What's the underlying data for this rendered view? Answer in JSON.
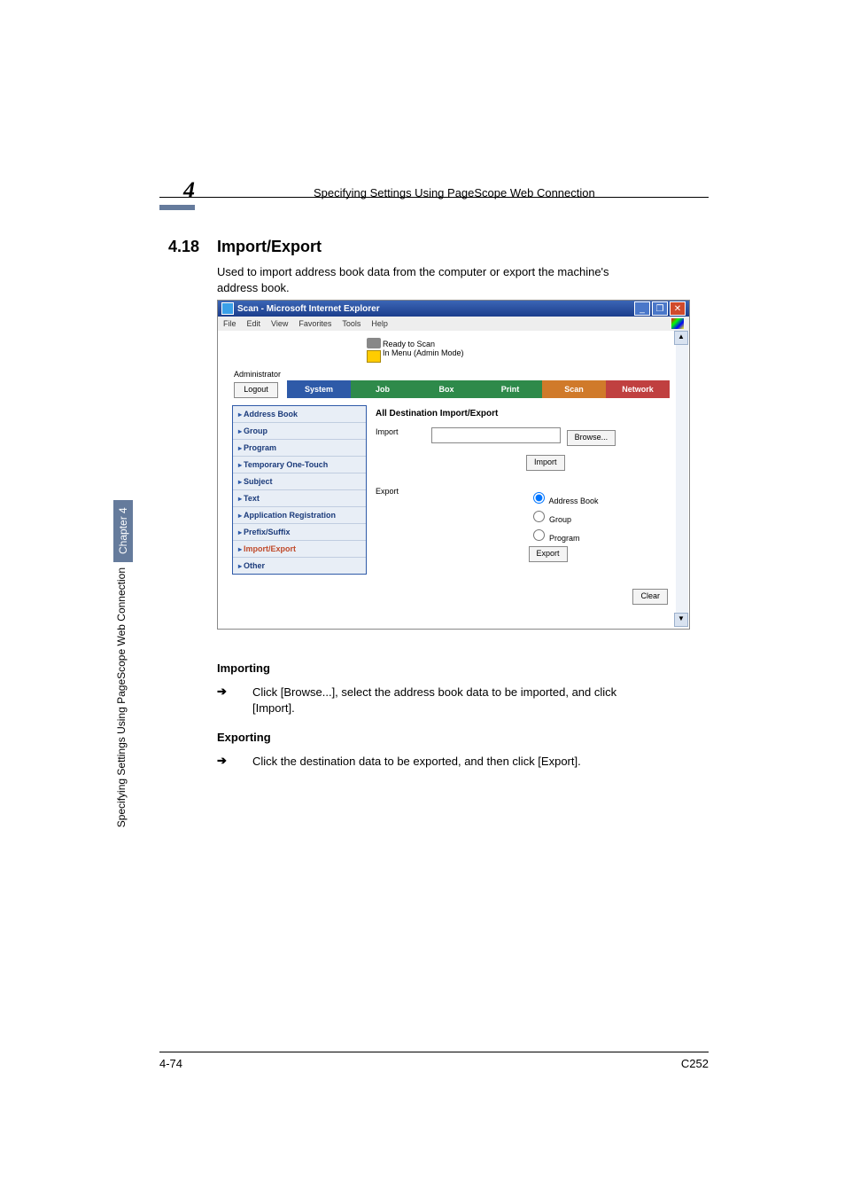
{
  "header": {
    "chapter_num": "4",
    "title": "Specifying Settings Using PageScope Web Connection"
  },
  "section": {
    "number": "4.18",
    "title": "Import/Export",
    "description": "Used to import address book data from the computer or export the machine's address book."
  },
  "importing": {
    "heading": "Importing",
    "arrow": "➔",
    "text": "Click [Browse...], select the address book data to be imported, and click [Import]."
  },
  "exporting": {
    "heading": "Exporting",
    "arrow": "➔",
    "text": "Click the destination data to be exported, and then click [Export]."
  },
  "footer": {
    "left": "4-74",
    "right": "C252"
  },
  "side": {
    "chapter": "Chapter 4",
    "label": "Specifying Settings Using PageScope Web Connection"
  },
  "screenshot": {
    "window_title": "Scan - Microsoft Internet Explorer",
    "menus": [
      "File",
      "Edit",
      "View",
      "Favorites",
      "Tools",
      "Help"
    ],
    "status1": "Ready to Scan",
    "status2": "In Menu (Admin Mode)",
    "admin_label": "Administrator",
    "logout": "Logout",
    "tabs": {
      "system": "System",
      "job": "Job",
      "box": "Box",
      "print": "Print",
      "scan": "Scan",
      "network": "Network"
    },
    "side_items": [
      "Address Book",
      "Group",
      "Program",
      "Temporary One-Touch",
      "Subject",
      "Text",
      "Application Registration",
      "Prefix/Suffix",
      "Import/Export",
      "Other"
    ],
    "panel_title": "All Destination Import/Export",
    "import_label": "Import",
    "browse": "Browse...",
    "import_btn": "Import",
    "export_label": "Export",
    "radios": {
      "address": "Address Book",
      "group": "Group",
      "program": "Program"
    },
    "export_btn": "Export",
    "clear": "Clear",
    "win_min": "_",
    "win_max": "❐",
    "win_close": "✕",
    "scroll_up": "▲",
    "scroll_down": "▼"
  }
}
